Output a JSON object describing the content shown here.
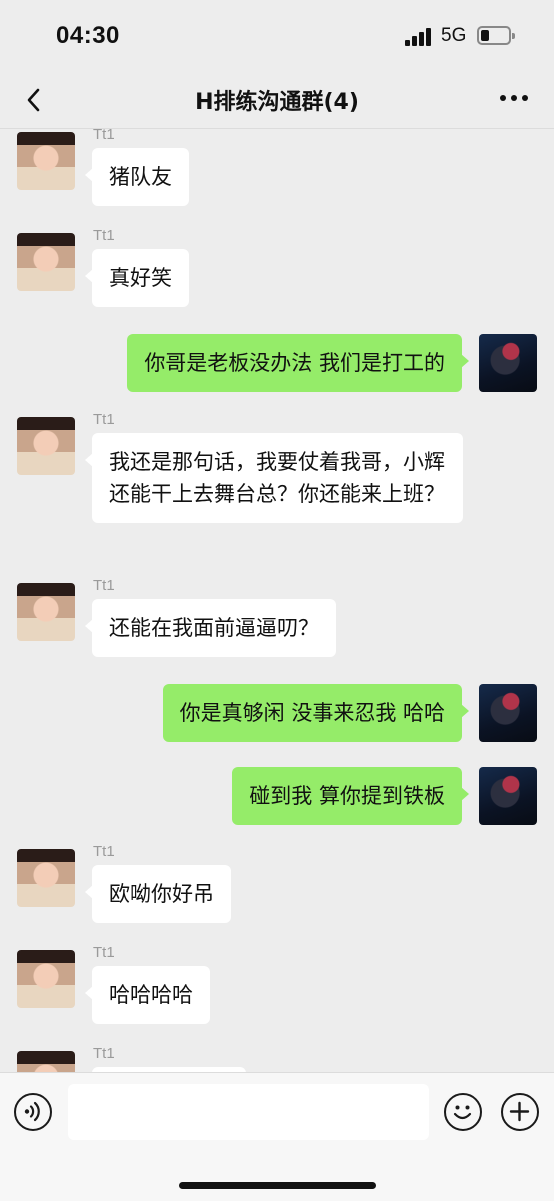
{
  "status_bar": {
    "time": "04:30",
    "network": "5G"
  },
  "header": {
    "title": "H排练沟通群(4)"
  },
  "chat": {
    "messages": [
      {
        "sender": "Tt1",
        "text": "猪队友"
      },
      {
        "sender": "Tt1",
        "text": "真好笑"
      },
      {
        "sender": "",
        "text": "你哥是老板没办法 我们是打工的"
      },
      {
        "sender": "Tt1",
        "text": "我还是那句话，我要仗着我哥，小辉还能干上去舞台总？你还能来上班？"
      },
      {
        "sender": "Tt1",
        "text": "还能在我面前逼逼叨？"
      },
      {
        "sender": "",
        "text": "你是真够闲 没事来忍我 哈哈"
      },
      {
        "sender": "",
        "text": "碰到我 算你提到铁板"
      },
      {
        "sender": "Tt1",
        "text": "欧呦你好吊"
      },
      {
        "sender": "Tt1",
        "text": "哈哈哈哈"
      },
      {
        "sender": "Tt1",
        "text": ""
      }
    ]
  },
  "input_bar": {
    "value": ""
  },
  "icons": {
    "back": "chevron-left-icon",
    "more": "more-icon",
    "voice": "voice-icon",
    "emoji": "emoji-icon",
    "plus": "plus-icon"
  },
  "colors": {
    "self_bubble": "#95ec69",
    "other_bubble": "#ffffff",
    "background": "#ededed"
  }
}
